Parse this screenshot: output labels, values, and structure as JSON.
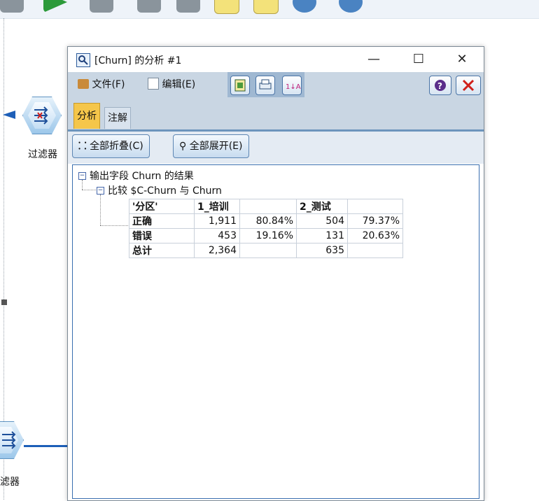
{
  "canvas": {
    "nodes": [
      {
        "label": "过滤器"
      },
      {
        "label": "滤器"
      }
    ]
  },
  "window": {
    "title": "[Churn] 的分析 #1",
    "controls": {
      "minimize": "—",
      "maximize": "☐",
      "close": "✕"
    }
  },
  "menu": {
    "file": "文件(F)",
    "edit": "编辑(E)"
  },
  "tabs": [
    {
      "label": "分析",
      "active": true
    },
    {
      "label": "注解",
      "active": false
    }
  ],
  "actions": {
    "collapse_all": "全部折叠(C)",
    "expand_all": "全部展开(E)"
  },
  "tree": {
    "root": "输出字段 Churn 的结果",
    "child": "比较 $C-Churn 与 Churn"
  },
  "table": {
    "header": [
      "'分区'",
      "1_培训",
      "",
      "2_测试",
      ""
    ],
    "rows": [
      [
        "正确",
        "1,911",
        "80.84%",
        "504",
        "79.37%"
      ],
      [
        "错误",
        "453",
        "19.16%",
        "131",
        "20.63%"
      ],
      [
        "总计",
        "2,364",
        "",
        "635",
        ""
      ]
    ]
  },
  "colors": {
    "accent_blue": "#3a6fb0",
    "menubar": "#c9d6e3",
    "active_tab": "#f5c64a",
    "close_red": "#d0201a"
  },
  "icons": [
    "search-icon",
    "file-icon",
    "edit-icon",
    "copy-icon",
    "print-icon",
    "sort-icon",
    "help-icon",
    "close-red-icon",
    "collapse-icon",
    "expand-icon"
  ]
}
